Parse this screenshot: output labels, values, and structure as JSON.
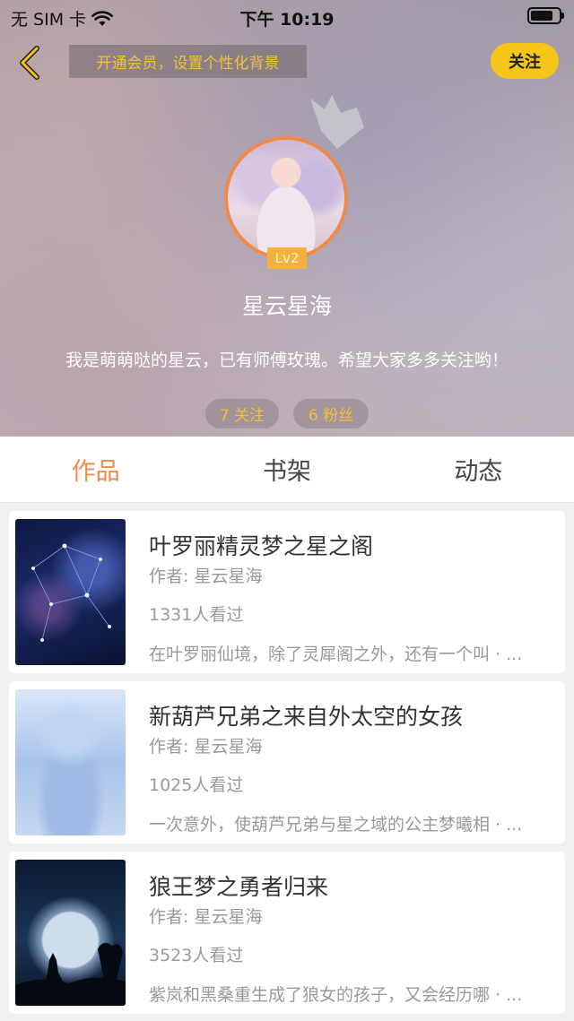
{
  "status_bar": {
    "carrier": "无 SIM 卡",
    "time": "下午 10:19"
  },
  "header": {
    "vip_banner": "开通会员，设置个性化背景",
    "follow_label": "关注",
    "level": "Lv2",
    "username": "星云星海",
    "bio": "我是萌萌哒的星云，已有师傅玫瑰。希望大家多多关注哟！",
    "following": "7 关注",
    "fans": "6 粉丝"
  },
  "tabs": [
    {
      "label": "作品",
      "active": true
    },
    {
      "label": "书架",
      "active": false
    },
    {
      "label": "动态",
      "active": false
    }
  ],
  "books": [
    {
      "title": "叶罗丽精灵梦之星之阁",
      "author": "作者: 星云星海",
      "views": "1331人看过",
      "desc": "在叶罗丽仙境，除了灵犀阁之外，还有一个叫 · ..."
    },
    {
      "title": "新葫芦兄弟之来自外太空的女孩",
      "author": "作者: 星云星海",
      "views": "1025人看过",
      "desc": "一次意外，使葫芦兄弟与星之域的公主梦曦相 · ..."
    },
    {
      "title": "狼王梦之勇者归来",
      "author": "作者: 星云星海",
      "views": "3523人看过",
      "desc": "紫岚和黑桑重生成了狼女的孩子，又会经历哪 · ..."
    }
  ],
  "colors": {
    "accent_orange": "#f0894c",
    "follow_yellow": "#f5c518",
    "stat_text": "#f0c23a"
  }
}
